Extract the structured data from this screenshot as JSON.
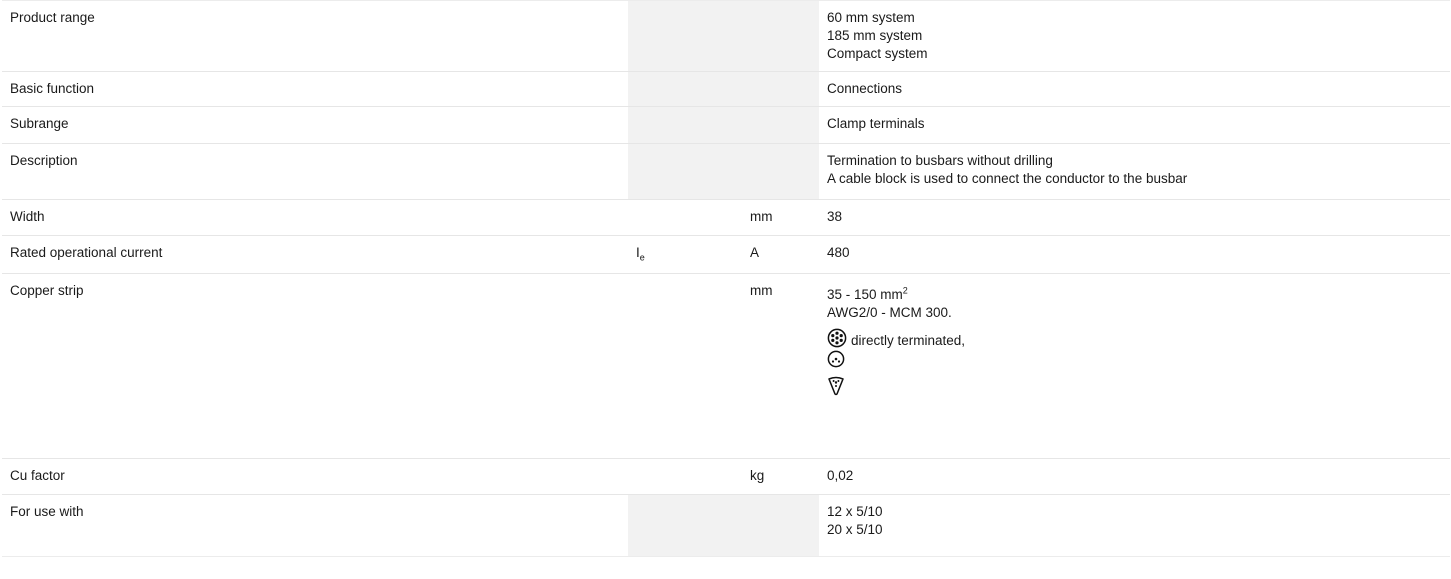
{
  "rows": [
    {
      "label": "Product range",
      "symbol": "",
      "symbol_sub": "",
      "unit": "",
      "values": [
        "60 mm system",
        "185 mm system",
        "Compact system"
      ]
    },
    {
      "label": "Basic function",
      "symbol": "",
      "symbol_sub": "",
      "unit": "",
      "values": [
        "Connections"
      ]
    },
    {
      "label": "Subrange",
      "symbol": "",
      "symbol_sub": "",
      "unit": "",
      "values": [
        "Clamp terminals"
      ]
    },
    {
      "label": "Description",
      "symbol": "",
      "symbol_sub": "",
      "unit": "",
      "values": [
        "Termination to busbars without drilling",
        "A cable block is used to connect the conductor to the busbar"
      ]
    },
    {
      "label": "Width",
      "symbol": "",
      "symbol_sub": "",
      "unit": "mm",
      "values": [
        "38"
      ]
    },
    {
      "label": "Rated operational current",
      "symbol": "I",
      "symbol_sub": "e",
      "unit": "A",
      "values": [
        "480"
      ]
    },
    {
      "label": "Copper strip",
      "symbol": "",
      "symbol_sub": "",
      "unit": "mm",
      "values": []
    },
    {
      "label": "Cu factor",
      "symbol": "",
      "symbol_sub": "",
      "unit": "kg",
      "values": [
        "0,02"
      ]
    },
    {
      "label": "For use with",
      "symbol": "",
      "symbol_sub": "",
      "unit": "",
      "values": [
        "12 x 5/10",
        "20 x 5/10"
      ]
    }
  ],
  "copper_strip": {
    "range_text": "35 - 150 mm",
    "range_sup": "2",
    "awg_text": "AWG2/0 - MCM 300.",
    "stranded_caption": "directly terminated,",
    "icons": [
      "stranded-conductor-icon",
      "solid-conductor-icon",
      "sector-conductor-icon"
    ]
  }
}
